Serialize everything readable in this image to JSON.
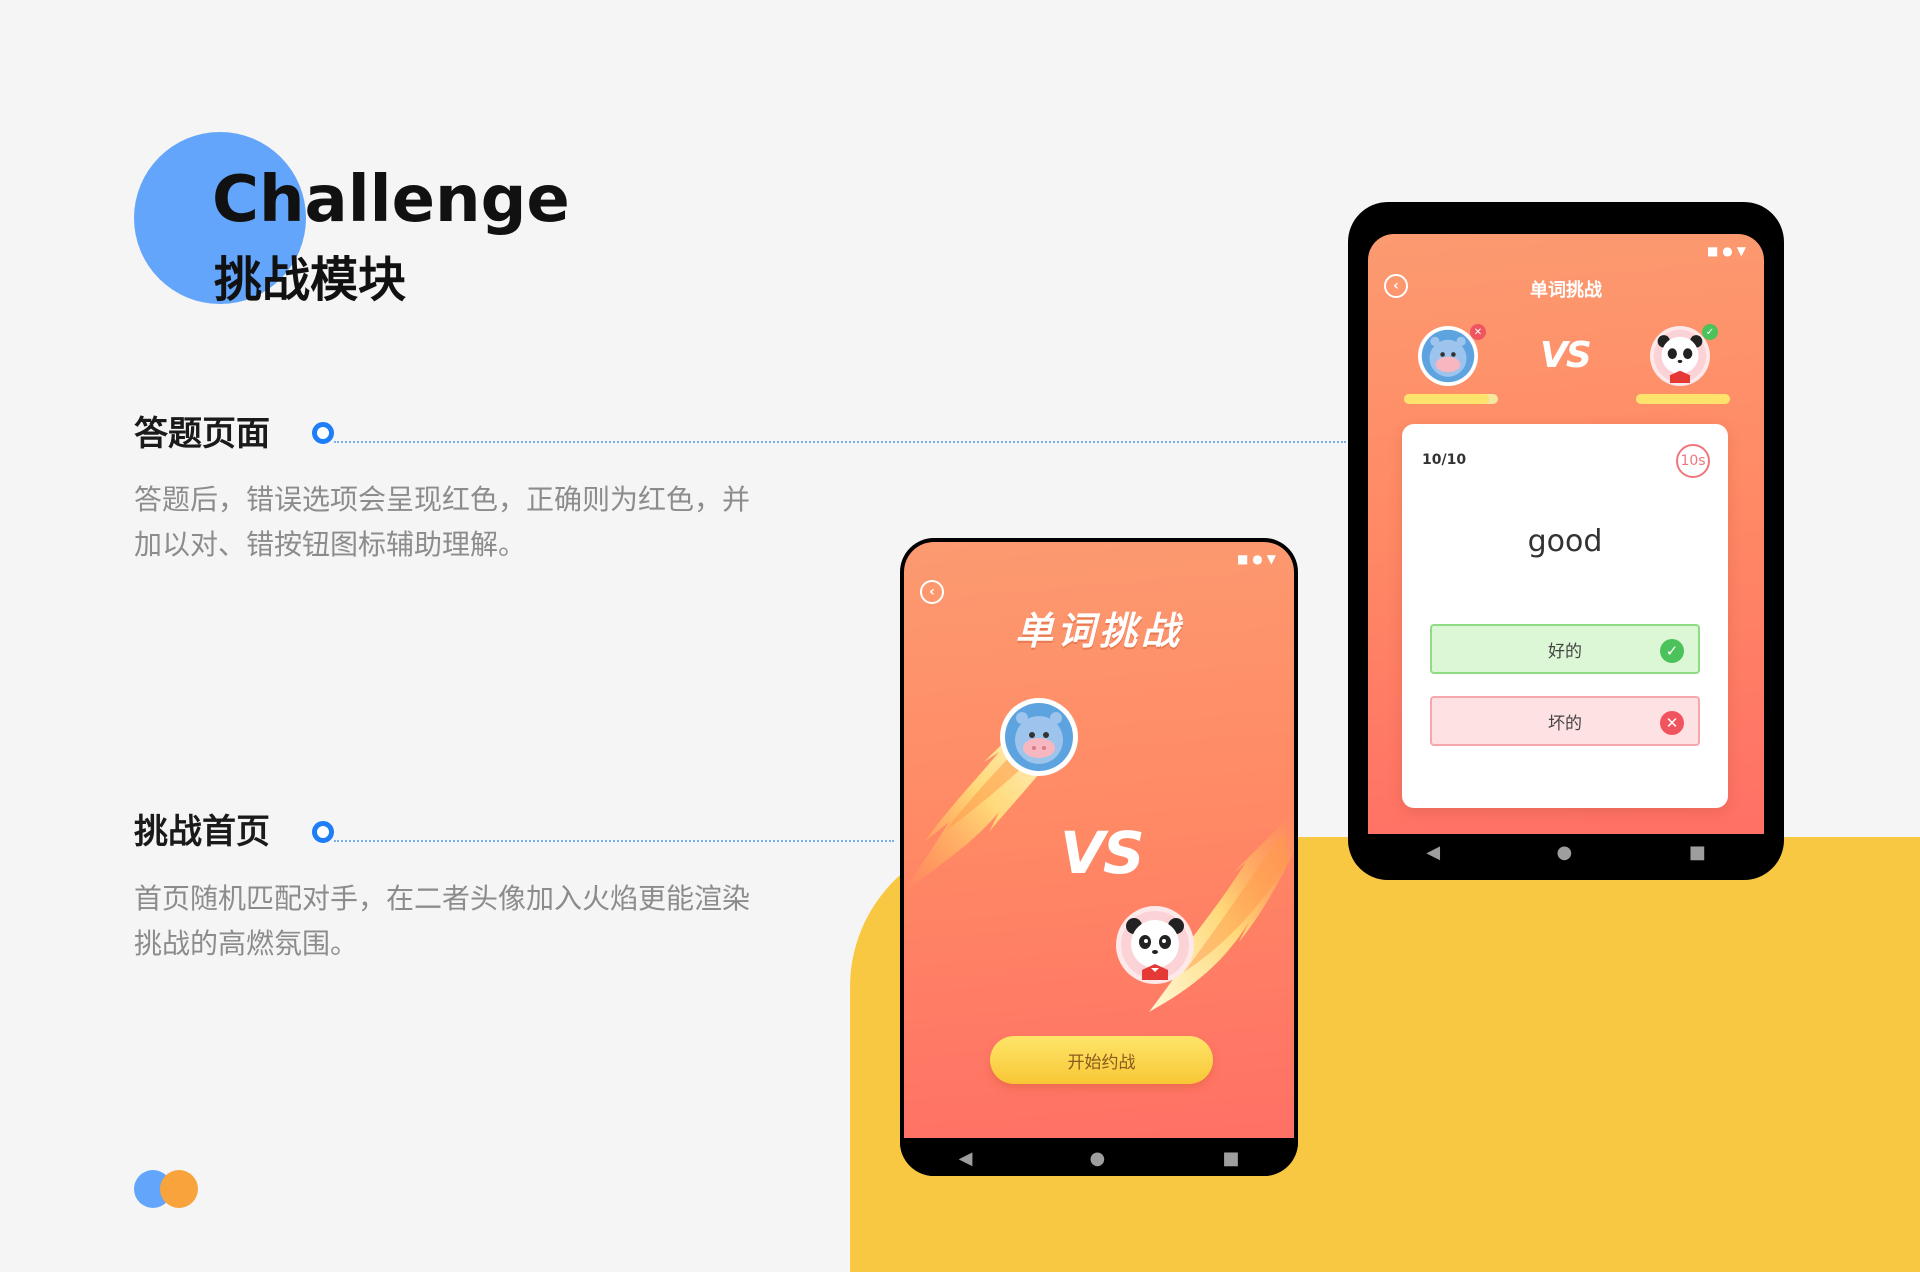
{
  "heading": {
    "title_en": "Challenge",
    "title_cn": "挑战模块"
  },
  "sections": [
    {
      "title": "答题页面",
      "desc_line1": "答题后，错误选项会呈现红色，正确则为红色，并",
      "desc_line2": "加以对、错按钮图标辅助理解。"
    },
    {
      "title": "挑战首页",
      "desc_line1": "首页随机匹配对手，在二者头像加入火焰更能渲染",
      "desc_line2": "挑战的高燃氛围。"
    }
  ],
  "home_screen": {
    "title": "单词挑战",
    "vs": "VS",
    "start_button": "开始约战",
    "back_icon": "chevron-left-icon",
    "player_left": "hippo-avatar",
    "player_right": "panda-avatar"
  },
  "quiz_screen": {
    "title": "单词挑战",
    "vs": "VS",
    "progress": "10/10",
    "timer": "10s",
    "word": "good",
    "options": [
      {
        "label": "好的",
        "state": "correct"
      },
      {
        "label": "坏的",
        "state": "wrong"
      }
    ],
    "player_left_progress": 0.9,
    "player_right_progress": 1.0
  },
  "colors": {
    "accent_blue": "#63a5fb",
    "accent_yellow": "#f8c843",
    "marker_blue": "#1e7ef8",
    "screen_gradient_top": "#fc9a70",
    "screen_gradient_bottom": "#ff7065",
    "correct_green": "#4cc25a",
    "wrong_red": "#f0545f"
  }
}
